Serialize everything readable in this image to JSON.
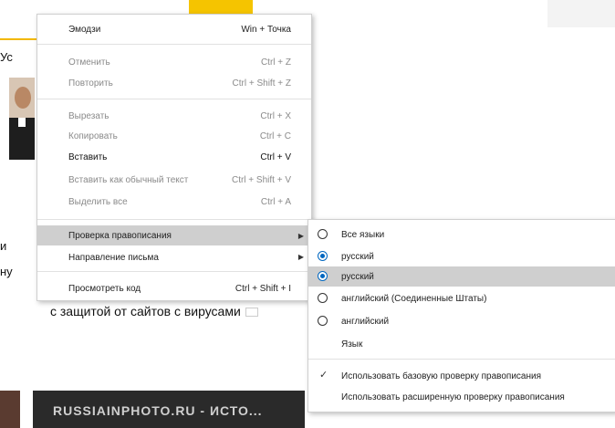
{
  "background": {
    "snip_top_left": "Ус",
    "snip_mid1": "и",
    "snip_mid2": "ну",
    "banner_text": "с защитой от сайтов с вирусами",
    "card_title": "RUSSIAINPHOTO.RU - ИСТО..."
  },
  "context_menu": {
    "items": [
      {
        "label": "Эмодзи",
        "shortcut": "Win + Точка"
      },
      {
        "label": "Отменить",
        "shortcut": "Ctrl + Z"
      },
      {
        "label": "Повторить",
        "shortcut": "Ctrl + Shift + Z"
      },
      {
        "label": "Вырезать",
        "shortcut": "Ctrl + X"
      },
      {
        "label": "Копировать",
        "shortcut": "Ctrl + C"
      },
      {
        "label": "Вставить",
        "shortcut": "Ctrl + V"
      },
      {
        "label": "Вставить как обычный текст",
        "shortcut": "Ctrl + Shift + V"
      },
      {
        "label": "Выделить все",
        "shortcut": "Ctrl + A"
      },
      {
        "label": "Проверка правописания",
        "shortcut": ""
      },
      {
        "label": "Направление письма",
        "shortcut": ""
      },
      {
        "label": "Просмотреть код",
        "shortcut": "Ctrl + Shift + I"
      }
    ]
  },
  "spellcheck_submenu": {
    "items": [
      {
        "label": "Все языки",
        "selected": false
      },
      {
        "label": "русский",
        "selected": true
      },
      {
        "label": "русский",
        "selected": true
      },
      {
        "label": "английский (Соединенные Штаты)",
        "selected": false
      },
      {
        "label": "английский",
        "selected": false
      },
      {
        "label": "Язык"
      },
      {
        "label": "Использовать базовую проверку правописания",
        "checked": true
      },
      {
        "label": "Использовать расширенную проверку правописания",
        "checked": false
      }
    ]
  },
  "colors": {
    "highlight": "#cfcfcf",
    "radio_accent": "#0067c0",
    "brand_yellow": "#f5c400"
  }
}
